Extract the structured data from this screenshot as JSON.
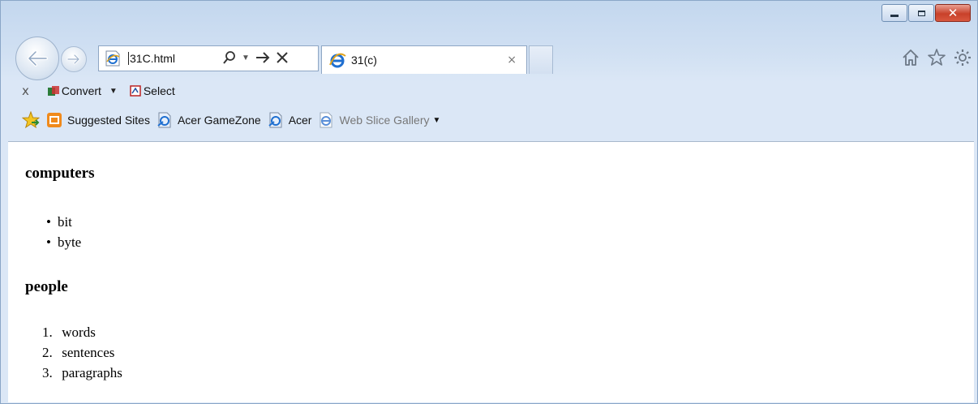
{
  "browser": {
    "address": {
      "url": "31C.html"
    },
    "tab": {
      "label": "31(c)",
      "close_glyph": "×"
    },
    "window_buttons": {
      "close_glyph": "✕"
    },
    "right_icons": [
      "home-icon",
      "star-icon",
      "gear-icon"
    ],
    "command_bar": {
      "close_glyph": "x",
      "convert_label": "Convert",
      "select_label": "Select"
    },
    "favorites_bar": {
      "items": [
        {
          "label": "Suggested Sites",
          "icon": "suggested-sites-icon"
        },
        {
          "label": "Acer GameZone",
          "icon": "ie-shortcut-icon"
        },
        {
          "label": "Acer",
          "icon": "ie-shortcut-icon"
        },
        {
          "label": "Web Slice Gallery",
          "icon": "ie-icon"
        }
      ]
    }
  },
  "page": {
    "heading1": "computers",
    "list1": [
      "bit",
      "byte"
    ],
    "heading2": "people",
    "list2": [
      {
        "num": "1.",
        "text": "words"
      },
      {
        "num": "2.",
        "text": "sentences"
      },
      {
        "num": "3.",
        "text": "paragraphs"
      }
    ]
  },
  "colors": {
    "chrome_top": "#c3d7ee",
    "chrome_bottom": "#dbe7f6",
    "close_button": "#c8412a",
    "ie_blue": "#1f6fd0"
  }
}
